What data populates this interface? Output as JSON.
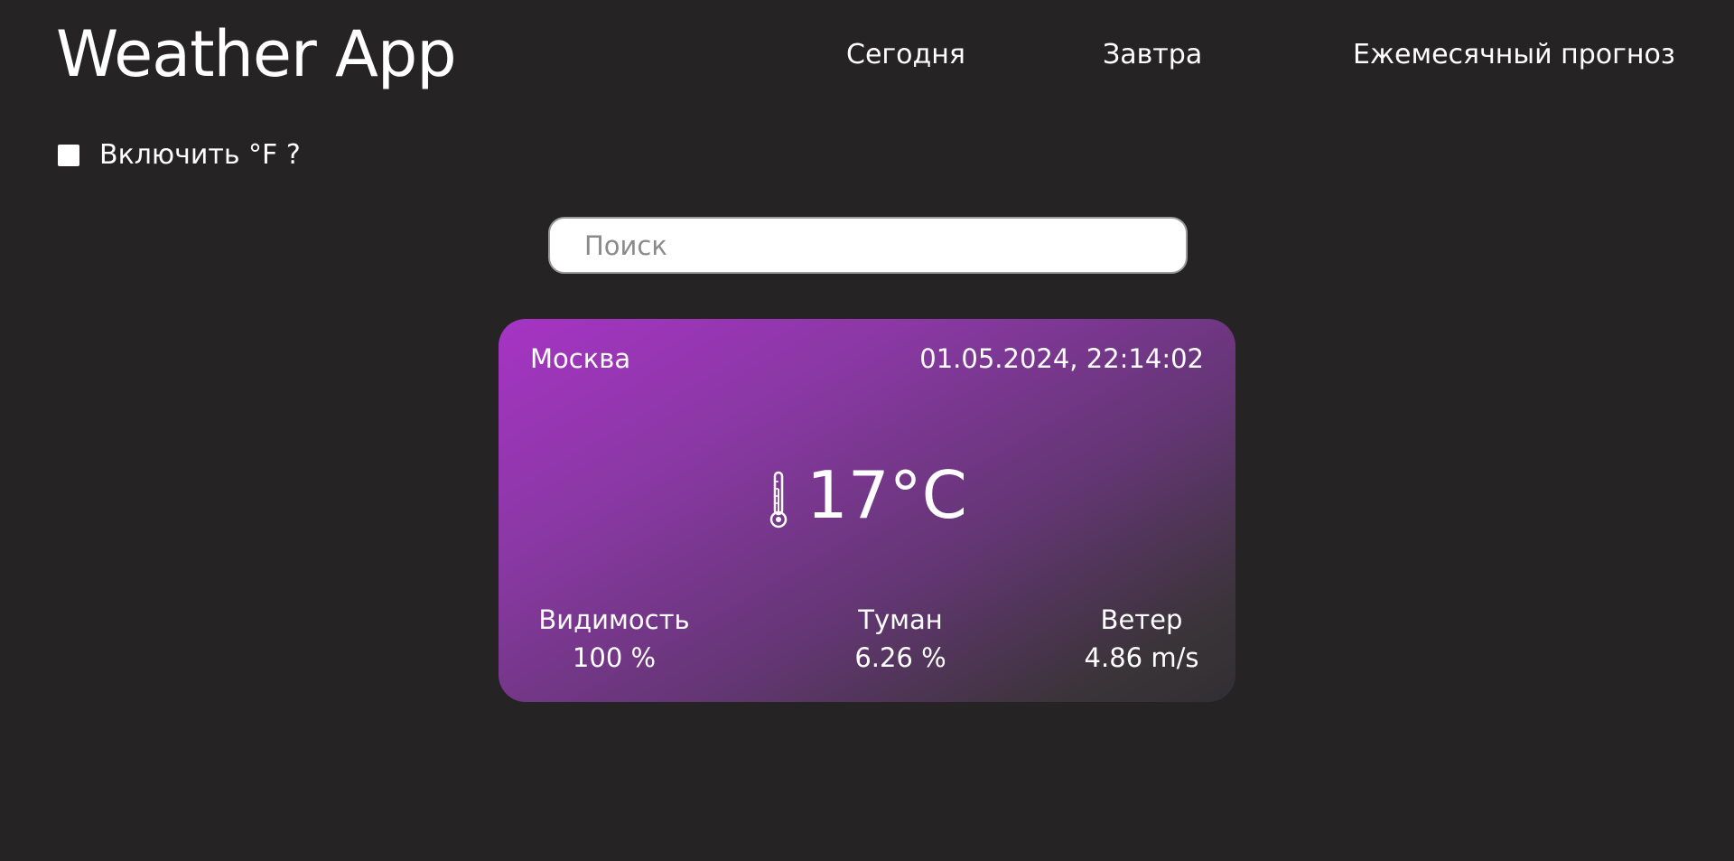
{
  "header": {
    "title": "Weather App",
    "nav": {
      "today": "Сегодня",
      "tomorrow": "Завтра",
      "monthly": "Ежемесячный прогноз"
    }
  },
  "unit_toggle": {
    "label": "Включить °F ?",
    "checked": false
  },
  "search": {
    "placeholder": "Поиск",
    "value": ""
  },
  "weather": {
    "city": "Москва",
    "datetime": "01.05.2024, 22:14:02",
    "temperature": "17°C",
    "temperature_icon": "thermometer-icon",
    "stats": {
      "visibility": {
        "label": "Видимость",
        "value": "100 %"
      },
      "fog": {
        "label": "Туман",
        "value": "6.26 %"
      },
      "wind": {
        "label": "Ветер",
        "value": "4.86 m/s"
      }
    }
  },
  "colors": {
    "background": "#252324",
    "card_gradient_start": "#a634c4",
    "card_gradient_end": "#312f33",
    "text": "#ffffff"
  }
}
